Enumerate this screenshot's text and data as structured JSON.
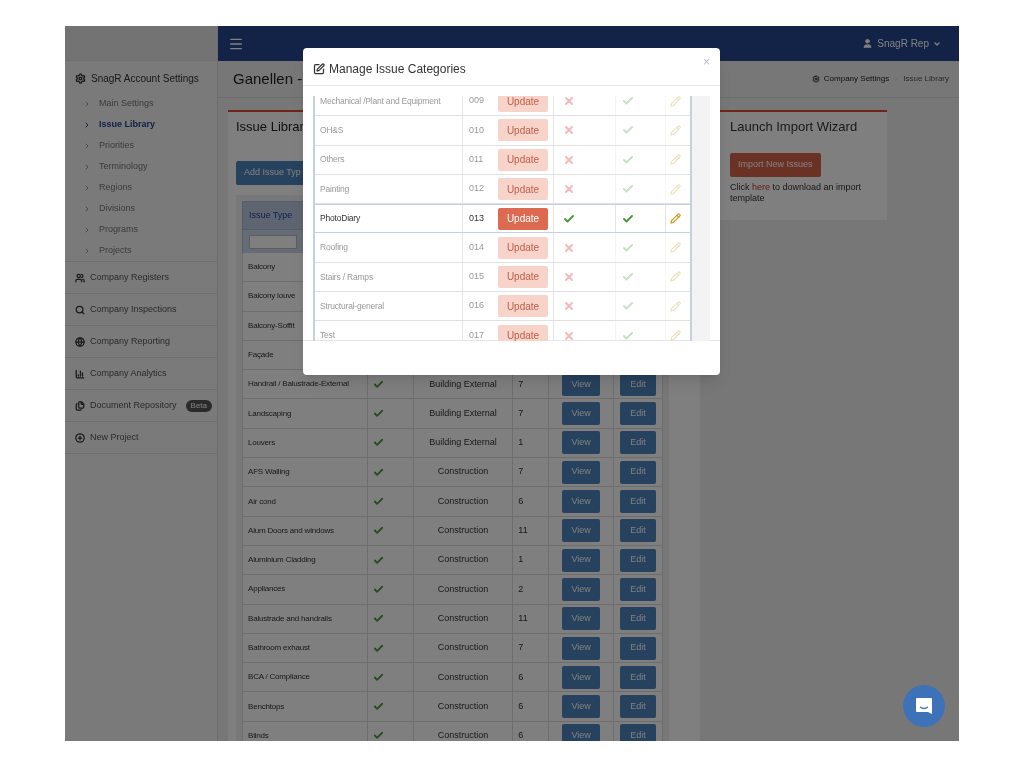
{
  "topbar": {
    "user": "SnagR Rep"
  },
  "sidebar": {
    "section": {
      "label": "SnagR Account Settings",
      "items": [
        {
          "label": "Main Settings",
          "selected": false
        },
        {
          "label": "Issue Library",
          "selected": true
        },
        {
          "label": "Priorities",
          "selected": false
        },
        {
          "label": "Terminology",
          "selected": false
        },
        {
          "label": "Regions",
          "selected": false
        },
        {
          "label": "Divisions",
          "selected": false
        },
        {
          "label": "Programs",
          "selected": false
        },
        {
          "label": "Projects",
          "selected": false
        }
      ]
    },
    "items": [
      {
        "label": "Company Registers"
      },
      {
        "label": "Company Inspections"
      },
      {
        "label": "Company Reporting"
      },
      {
        "label": "Company Analytics"
      },
      {
        "label": "Document Repository",
        "badge": "Beta"
      },
      {
        "label": "New Project"
      }
    ]
  },
  "page": {
    "title": "Ganellen -",
    "breadcrumb": [
      "Company Settings",
      "Issue Library"
    ]
  },
  "library_panel": {
    "title": "Issue Librar",
    "add_button": "Add Issue Typ",
    "columns": [
      "Issue Type"
    ],
    "rows": [
      {
        "issue_type": "Balcony"
      },
      {
        "issue_type": "Balcony louve"
      },
      {
        "issue_type": "Balcony-Soffit"
      },
      {
        "issue_type": "Façade"
      },
      {
        "issue_type": "Handrail / Balustrade-External",
        "checked": true,
        "category": "Building External",
        "count": "7",
        "view": "View",
        "edit": "Edit"
      },
      {
        "issue_type": "Landscaping",
        "checked": true,
        "category": "Building External",
        "count": "7",
        "view": "View",
        "edit": "Edit"
      },
      {
        "issue_type": "Louvers",
        "checked": true,
        "category": "Building External",
        "count": "1",
        "view": "View",
        "edit": "Edit"
      },
      {
        "issue_type": "AFS Walling",
        "checked": true,
        "category": "Construction",
        "count": "7",
        "view": "View",
        "edit": "Edit"
      },
      {
        "issue_type": "Air cond",
        "checked": true,
        "category": "Construction",
        "count": "6",
        "view": "View",
        "edit": "Edit"
      },
      {
        "issue_type": "Alum Doors and windows",
        "checked": true,
        "category": "Construction",
        "count": "11",
        "view": "View",
        "edit": "Edit"
      },
      {
        "issue_type": "Aluminium Cladding",
        "checked": true,
        "category": "Construction",
        "count": "1",
        "view": "View",
        "edit": "Edit"
      },
      {
        "issue_type": "Appliances",
        "checked": true,
        "category": "Construction",
        "count": "2",
        "view": "View",
        "edit": "Edit"
      },
      {
        "issue_type": "Balustrade and handrails",
        "checked": true,
        "category": "Construction",
        "count": "11",
        "view": "View",
        "edit": "Edit"
      },
      {
        "issue_type": "Bathroom exhaust",
        "checked": true,
        "category": "Construction",
        "count": "7",
        "view": "View",
        "edit": "Edit"
      },
      {
        "issue_type": "BCA / Compliance",
        "checked": true,
        "category": "Construction",
        "count": "6",
        "view": "View",
        "edit": "Edit"
      },
      {
        "issue_type": "Benchtops",
        "checked": true,
        "category": "Construction",
        "count": "6",
        "view": "View",
        "edit": "Edit"
      },
      {
        "issue_type": "Blinds",
        "checked": true,
        "category": "Construction",
        "count": "6",
        "view": "View",
        "edit": "Edit"
      }
    ]
  },
  "import_panel": {
    "title": "Launch Import Wizard",
    "button": "Import New Issues",
    "note_before": "Click ",
    "link": "here",
    "note_after": " to download an import template"
  },
  "modal": {
    "title": "Manage Issue Categories",
    "close": "×",
    "rows": [
      {
        "name": "Mechanical /Plant and Equipment",
        "code": "009",
        "button": "Update",
        "enabled": false,
        "selected": false
      },
      {
        "name": "OH&S",
        "code": "010",
        "button": "Update",
        "enabled": false,
        "selected": false
      },
      {
        "name": "Others",
        "code": "011",
        "button": "Update",
        "enabled": false,
        "selected": false
      },
      {
        "name": "Painting",
        "code": "012",
        "button": "Update",
        "enabled": false,
        "selected": false
      },
      {
        "name": "PhotoDiary",
        "code": "013",
        "button": "Update",
        "enabled": true,
        "selected": true
      },
      {
        "name": "Roofing",
        "code": "014",
        "button": "Update",
        "enabled": false,
        "selected": false
      },
      {
        "name": "Stairs / Ramps",
        "code": "015",
        "button": "Update",
        "enabled": false,
        "selected": false
      },
      {
        "name": "Structural-general",
        "code": "016",
        "button": "Update",
        "enabled": false,
        "selected": false
      },
      {
        "name": "Test",
        "code": "017",
        "button": "Update",
        "enabled": false,
        "selected": false
      }
    ]
  }
}
